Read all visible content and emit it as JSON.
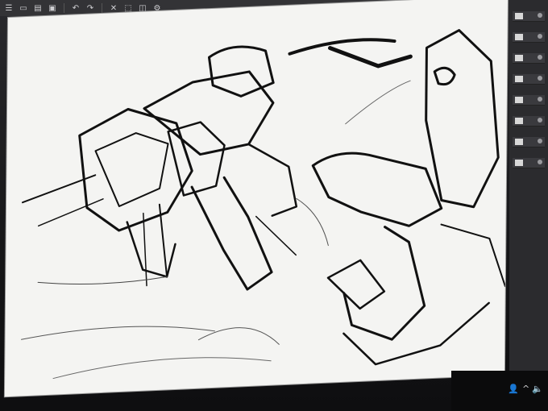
{
  "toolbar": {
    "icons": [
      "menu-icon",
      "new-file-icon",
      "open-icon",
      "save-icon",
      "undo-icon",
      "redo-icon",
      "clear-icon",
      "transform-icon",
      "select-icon",
      "settings-icon"
    ]
  },
  "layers": {
    "count": 8
  },
  "taskbar": {
    "icons": [
      "person-icon",
      "up-arrow-icon",
      "speaker-icon"
    ]
  },
  "colors": {
    "canvas": "#f4f4f2",
    "ink": "#111111",
    "ui_dark": "#2b2b2e"
  }
}
